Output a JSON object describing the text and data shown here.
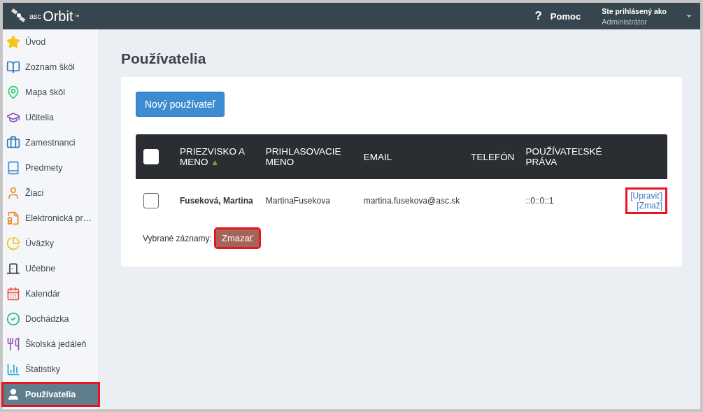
{
  "header": {
    "logo_prefix": "asc",
    "logo_name": "Orbit",
    "logo_mark": "™",
    "help": "Pomoc",
    "help_mark": "?",
    "login_label": "Ste prihlásený ako",
    "user": "Administrátor"
  },
  "sidebar": {
    "items": [
      {
        "label": "Úvod",
        "selected": false,
        "highlighted": false
      },
      {
        "label": "Zoznam škôl",
        "selected": false,
        "highlighted": false
      },
      {
        "label": "Mapa škôl",
        "selected": false,
        "highlighted": false
      },
      {
        "label": "Učitelia",
        "selected": false,
        "highlighted": false
      },
      {
        "label": "Zamestnanci",
        "selected": false,
        "highlighted": false
      },
      {
        "label": "Predmety",
        "selected": false,
        "highlighted": false
      },
      {
        "label": "Žiaci",
        "selected": false,
        "highlighted": false
      },
      {
        "label": "Elektronická pr…",
        "selected": false,
        "highlighted": false
      },
      {
        "label": "Úväzky",
        "selected": false,
        "highlighted": false
      },
      {
        "label": "Učebne",
        "selected": false,
        "highlighted": false
      },
      {
        "label": "Kalendár",
        "selected": false,
        "highlighted": false
      },
      {
        "label": "Dochádzka",
        "selected": false,
        "highlighted": false
      },
      {
        "label": "Školská jedáleň",
        "selected": false,
        "highlighted": false
      },
      {
        "label": "Štatistiky",
        "selected": false,
        "highlighted": false
      },
      {
        "label": "Používatelia",
        "selected": true,
        "highlighted": true
      }
    ]
  },
  "page": {
    "title": "Používatelia",
    "new_button": "Nový používateľ"
  },
  "table": {
    "columns": [
      {
        "label": "PRIEZVISKO A MENO",
        "sorted": true
      },
      {
        "label": "PRIHLASOVACIE MENO",
        "sorted": false
      },
      {
        "label": "EMAIL",
        "sorted": false
      },
      {
        "label": "TELEFÓN",
        "sorted": false
      },
      {
        "label": "POUŽÍVATEĽSKÉ PRÁVA",
        "sorted": false
      }
    ],
    "sort_mark": "▲",
    "header_checked": false,
    "rows": [
      {
        "checked": false,
        "name": "Fuseková, Martina",
        "login": "MartinaFusekova",
        "email": "martina.fusekova@asc.sk",
        "rights": "::0::0::1",
        "edit": "[Upraviť]",
        "delete": "[Zmaž]",
        "actions_highlighted": true
      }
    ]
  },
  "footer": {
    "label": "Vybrané záznamy:",
    "delete_button": "Zmazať",
    "highlighted": true
  }
}
